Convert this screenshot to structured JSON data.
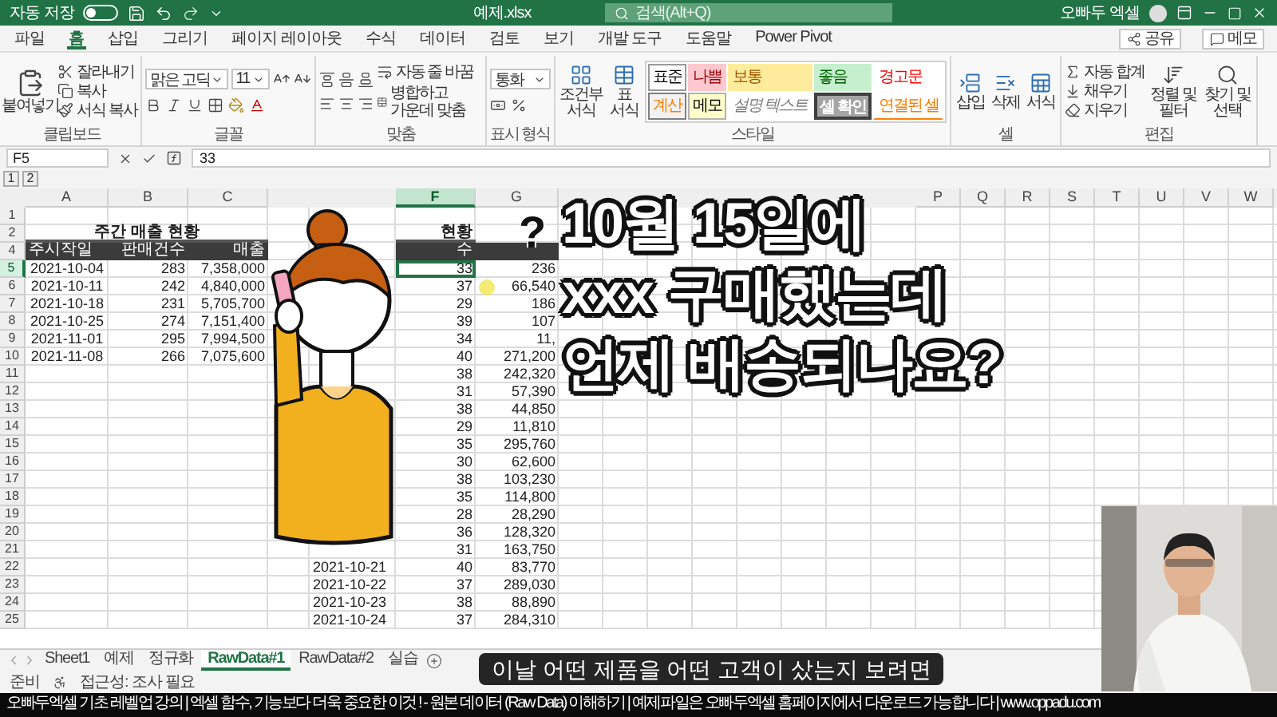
{
  "title_bar": {
    "autosave_label": "자동 저장",
    "autosave_on": false,
    "filename": "예제.xlsx",
    "search_placeholder": "검색(Alt+Q)",
    "user": "오빠두 엑셀"
  },
  "ribbon_tabs": [
    {
      "label": "파일",
      "selected": false
    },
    {
      "label": "홈",
      "selected": true
    },
    {
      "label": "삽입",
      "selected": false
    },
    {
      "label": "그리기",
      "selected": false
    },
    {
      "label": "페이지 레이아웃",
      "selected": false
    },
    {
      "label": "수식",
      "selected": false
    },
    {
      "label": "데이터",
      "selected": false
    },
    {
      "label": "검토",
      "selected": false
    },
    {
      "label": "보기",
      "selected": false
    },
    {
      "label": "개발 도구",
      "selected": false
    },
    {
      "label": "도움말",
      "selected": false
    },
    {
      "label": "Power Pivot",
      "selected": false
    }
  ],
  "ribbon_actions": [
    "공유",
    "메모"
  ],
  "ribbon": {
    "clipboard": {
      "label": "클립보드",
      "paste": "붙여넣기",
      "items": [
        "잘라내기",
        "복사",
        "서식 복사"
      ]
    },
    "font": {
      "label": "글꼴",
      "font_name": "맑은 고딕",
      "font_size": "11"
    },
    "alignment": {
      "label": "맞춤",
      "wrap": "자동 줄 바꿈",
      "merge": "병합하고 가운데 맞춤"
    },
    "number": {
      "label": "표시 형식",
      "format": "통화"
    },
    "styles": {
      "label": "스타일",
      "conditional": "조건부 서식",
      "table": "표 서식",
      "cell_styles": [
        {
          "label": "표준",
          "kind": "normal"
        },
        {
          "label": "나쁨",
          "kind": "bad"
        },
        {
          "label": "보통",
          "kind": "neutral"
        },
        {
          "label": "좋음",
          "kind": "good"
        },
        {
          "label": "경고문",
          "kind": "warning"
        },
        {
          "label": "계산",
          "kind": "calculation"
        },
        {
          "label": "메모",
          "kind": "note"
        },
        {
          "label": "설명 텍스트",
          "kind": "explanatory"
        },
        {
          "label": "셀 확인",
          "kind": "check"
        },
        {
          "label": "연결된 셀",
          "kind": "linked"
        }
      ]
    },
    "cells": {
      "label": "셀",
      "items": [
        "삽입",
        "삭제",
        "서식"
      ]
    },
    "editing": {
      "label": "편집",
      "items": [
        "자동 합계",
        "채우기",
        "지우기"
      ],
      "sort": "정렬 및 필터",
      "find": "찾기 및 선택"
    }
  },
  "formula_bar": {
    "name_box": "F5",
    "value": "33"
  },
  "outline_levels": [
    "1",
    "2"
  ],
  "columns": [
    {
      "letter": "A",
      "selected": false
    },
    {
      "letter": "B",
      "selected": false
    },
    {
      "letter": "C",
      "selected": false
    },
    null,
    null,
    {
      "letter": "F",
      "selected": true
    },
    {
      "letter": "G",
      "selected": false
    },
    null,
    null,
    null,
    null,
    null,
    null,
    null,
    null,
    {
      "letter": "P",
      "selected": false
    },
    {
      "letter": "Q",
      "selected": false
    },
    {
      "letter": "R",
      "selected": false
    },
    {
      "letter": "S",
      "selected": false
    },
    {
      "letter": "T",
      "selected": false
    },
    {
      "letter": "U",
      "selected": false
    },
    {
      "letter": "V",
      "selected": false
    },
    {
      "letter": "W",
      "selected": false
    }
  ],
  "rows": [
    {
      "number": "1",
      "kind": "plain",
      "selected": false,
      "cells": []
    },
    {
      "number": "2",
      "kind": "title",
      "selected": false,
      "cells": [
        "주간 매출 현황",
        null,
        null,
        null,
        null,
        "현황"
      ]
    },
    {
      "number": "4",
      "kind": "header",
      "selected": false,
      "cells": [
        "주시작일",
        "판매건수",
        "매출",
        null,
        null,
        "수"
      ]
    },
    {
      "number": "5",
      "kind": "plain",
      "selected": true,
      "cells": [
        "2021-10-04",
        "283",
        "7,358,000",
        null,
        null,
        "33",
        "236"
      ]
    },
    {
      "number": "6",
      "kind": "plain",
      "selected": false,
      "cells": [
        "2021-10-11",
        "242",
        "4,840,000",
        null,
        null,
        "37",
        "66,540"
      ]
    },
    {
      "number": "7",
      "kind": "plain",
      "selected": false,
      "cells": [
        "2021-10-18",
        "231",
        "5,705,700",
        null,
        null,
        "29",
        "186"
      ]
    },
    {
      "number": "8",
      "kind": "plain",
      "selected": false,
      "cells": [
        "2021-10-25",
        "274",
        "7,151,400",
        null,
        null,
        "39",
        "107"
      ]
    },
    {
      "number": "9",
      "kind": "plain",
      "selected": false,
      "cells": [
        "2021-11-01",
        "295",
        "7,994,500",
        null,
        null,
        "34",
        "11,"
      ]
    },
    {
      "number": "10",
      "kind": "plain",
      "selected": false,
      "cells": [
        "2021-11-08",
        "266",
        "7,075,600",
        null,
        null,
        "40",
        "271,200"
      ]
    },
    {
      "number": "11",
      "kind": "plain",
      "selected": false,
      "cells": [
        null,
        null,
        null,
        null,
        null,
        "38",
        "242,320"
      ]
    },
    {
      "number": "12",
      "kind": "plain",
      "selected": false,
      "cells": [
        null,
        null,
        null,
        null,
        null,
        "31",
        "57,390"
      ]
    },
    {
      "number": "13",
      "kind": "plain",
      "selected": false,
      "cells": [
        null,
        null,
        null,
        null,
        null,
        "38",
        "44,850"
      ]
    },
    {
      "number": "14",
      "kind": "plain",
      "selected": false,
      "cells": [
        null,
        null,
        null,
        null,
        null,
        "29",
        "11,810"
      ]
    },
    {
      "number": "15",
      "kind": "plain",
      "selected": false,
      "cells": [
        null,
        null,
        null,
        null,
        null,
        "35",
        "295,760"
      ]
    },
    {
      "number": "16",
      "kind": "plain",
      "selected": false,
      "cells": [
        null,
        null,
        null,
        null,
        null,
        "30",
        "62,600"
      ]
    },
    {
      "number": "17",
      "kind": "plain",
      "selected": false,
      "cells": [
        null,
        null,
        null,
        null,
        null,
        "38",
        "103,230"
      ]
    },
    {
      "number": "18",
      "kind": "plain",
      "selected": false,
      "cells": [
        null,
        null,
        null,
        null,
        null,
        "35",
        "114,800"
      ]
    },
    {
      "number": "19",
      "kind": "plain",
      "selected": false,
      "cells": [
        null,
        null,
        null,
        null,
        null,
        "28",
        "28,290"
      ]
    },
    {
      "number": "20",
      "kind": "plain",
      "selected": false,
      "cells": [
        null,
        null,
        null,
        null,
        null,
        "36",
        "128,320"
      ]
    },
    {
      "number": "21",
      "kind": "plain",
      "selected": false,
      "cells": [
        null,
        null,
        null,
        null,
        null,
        "31",
        "163,750"
      ]
    },
    {
      "number": "22",
      "kind": "plain",
      "selected": false,
      "cells": [
        null,
        null,
        null,
        null,
        "2021-10-21",
        "40",
        "83,770"
      ]
    },
    {
      "number": "23",
      "kind": "plain",
      "selected": false,
      "cells": [
        null,
        null,
        null,
        null,
        "2021-10-22",
        "37",
        "289,030"
      ]
    },
    {
      "number": "24",
      "kind": "plain",
      "selected": false,
      "cells": [
        null,
        null,
        null,
        null,
        "2021-10-23",
        "38",
        "88,890"
      ]
    },
    {
      "number": "25",
      "kind": "plain",
      "selected": false,
      "cells": [
        null,
        null,
        null,
        null,
        "2021-10-24",
        "37",
        "284,310"
      ]
    }
  ],
  "sheet_tabs": [
    {
      "label": "Sheet1",
      "selected": false
    },
    {
      "label": "예제",
      "selected": false
    },
    {
      "label": "정규화",
      "selected": false
    },
    {
      "label": "RawData#1",
      "selected": true
    },
    {
      "label": "RawData#2",
      "selected": false
    },
    {
      "label": "실습",
      "selected": false
    }
  ],
  "status_bar": [
    "준비",
    "접근성: 조사 필요"
  ],
  "overlay": {
    "question": "?",
    "lines": [
      "10월 15일에",
      "xxx 구매했는데",
      "언제 배송되나요?"
    ],
    "subtitle": "이날 어떤 제품을 어떤 고객이 샀는지 보려면"
  },
  "banner": "오빠두엑셀 기초 레벨업 강의 | 엑셀 함수, 기능보다 더욱 중요한 이것 ! - 원본 데이터 (Raw Data) 이해하기 | 예제파일은 오빠두엑셀 홈페이지에서 다운로드 가능합니다 | www.oppadu.com"
}
